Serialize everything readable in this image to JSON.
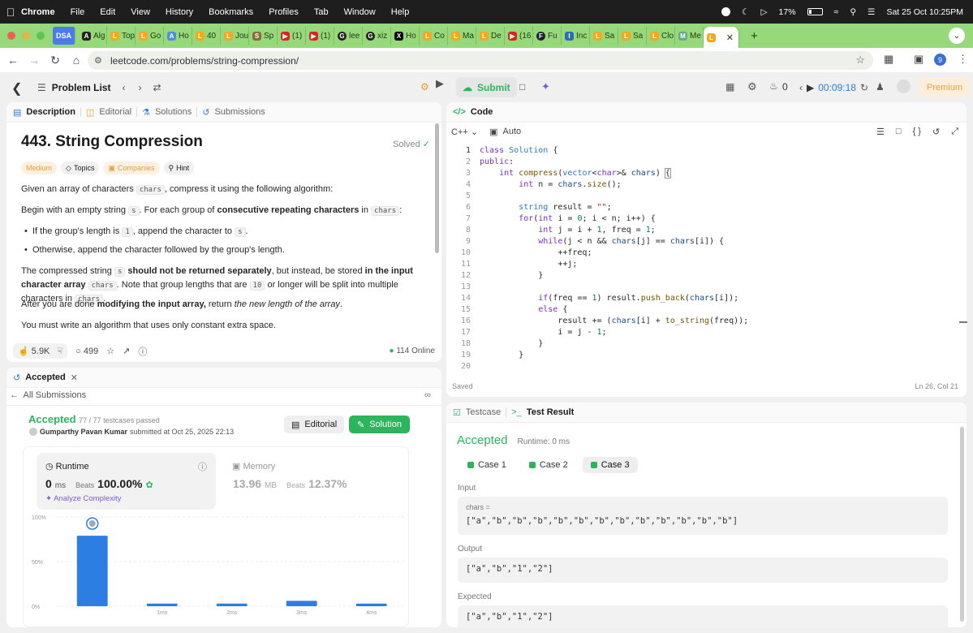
{
  "menubar": {
    "apple": "",
    "items": [
      "Chrome",
      "File",
      "Edit",
      "View",
      "History",
      "Bookmarks",
      "Profiles",
      "Tab",
      "Window",
      "Help"
    ],
    "battery": "17%",
    "datetime": "Sat 25 Oct  10:25PM"
  },
  "tabs": [
    {
      "label": "DSA"
    },
    {
      "label": "Alg"
    },
    {
      "label": "Top"
    },
    {
      "label": "Go"
    },
    {
      "label": "Ho"
    },
    {
      "label": "40"
    },
    {
      "label": "Jou"
    },
    {
      "label": "Sp"
    },
    {
      "label": "(1)"
    },
    {
      "label": "(1)"
    },
    {
      "label": "lee"
    },
    {
      "label": "xiz"
    },
    {
      "label": "Ho"
    },
    {
      "label": "Co"
    },
    {
      "label": "Ma"
    },
    {
      "label": "De"
    },
    {
      "label": "(16"
    },
    {
      "label": "Fu"
    },
    {
      "label": "Inc"
    },
    {
      "label": "Sa"
    },
    {
      "label": "Sa"
    },
    {
      "label": "Clo"
    },
    {
      "label": "Me"
    }
  ],
  "address": {
    "url": "leetcode.com/problems/string-compression/",
    "profile_initial": "9"
  },
  "lc": {
    "problem_list": "Problem List",
    "submit": "Submit",
    "streak": "0",
    "timer": "00:09:18",
    "premium": "Premium"
  },
  "desc": {
    "tabs": {
      "description": "Description",
      "editorial": "Editorial",
      "solutions": "Solutions",
      "submissions": "Submissions"
    },
    "title": "443. String Compression",
    "solved": "Solved",
    "pills": {
      "difficulty": "Medium",
      "topics": "Topics",
      "companies": "Companies",
      "hint": "Hint"
    },
    "p1a": "Given an array of characters ",
    "p1code": "chars",
    "p1b": ", compress it using the following algorithm:",
    "p2a": "Begin with an empty string ",
    "p2code": "s",
    "p2b": ". For each group of ",
    "p2bold": "consecutive repeating characters",
    "p2c": " in ",
    "p2code2": "chars",
    "p2d": ":",
    "b1a": "If the group's length is ",
    "b1code": "1",
    "b1b": ", append the character to ",
    "b1code2": "s",
    "b1c": ".",
    "b2": "Otherwise, append the character followed by the group's length.",
    "p3a": "The compressed string ",
    "p3code": "s",
    "p3bold": " should not be returned separately",
    "p3b": ", but instead, be stored ",
    "p3bold2": "in the input character array",
    "p3code2": "chars",
    "p3c": ". Note that group lengths that are ",
    "p3code3": "10",
    "p3d": " or longer will be split into multiple characters in ",
    "p3code4": "chars",
    "p3e": ".",
    "p4a": "After you are done ",
    "p4bold": "modifying the input array,",
    "p4b": " return ",
    "p4ital": "the new length of the array",
    "p4c": ".",
    "p5": "You must write an algorithm that uses only constant extra space.",
    "likes": "5.9K",
    "comments": "499",
    "online": "114 Online"
  },
  "code": {
    "header": "Code",
    "lang": "C++",
    "mode": "Auto",
    "saved": "Saved",
    "cursor": "Ln 26, Col 21",
    "lines": [
      "1",
      "2",
      "3",
      "4",
      "5",
      "6",
      "7",
      "8",
      "9",
      "10",
      "11",
      "12",
      "13",
      "14",
      "15",
      "16",
      "17",
      "18",
      "19",
      "20"
    ]
  },
  "accepted_panel": {
    "tab": "Accepted",
    "all": "All Submissions",
    "status": "Accepted",
    "tests": "77 / 77 testcases passed",
    "user": "Gumparthy Pavan Kumar",
    "submitted": "submitted at Oct 25, 2025 22:13",
    "editorial": "Editorial",
    "solution": "Solution",
    "runtime_label": "Runtime",
    "runtime_val": "0",
    "runtime_unit": "ms",
    "beats": "Beats",
    "runtime_beats": "100.00%",
    "analyze": "Analyze Complexity",
    "memory_label": "Memory",
    "memory_val": "13.96",
    "memory_unit": "MB",
    "memory_beats": "12.37%",
    "chart_data": {
      "type": "bar",
      "categories": [
        "",
        "1ms",
        "2ms",
        "3ms",
        "4ms"
      ],
      "values": [
        79,
        3,
        3,
        6,
        3
      ],
      "ylim": [
        0,
        100
      ],
      "yticks": [
        "100%",
        "50%",
        "0%"
      ],
      "highlight_index": 0
    }
  },
  "result": {
    "testcase": "Testcase",
    "test_result": "Test Result",
    "status": "Accepted",
    "runtime": "Runtime: 0 ms",
    "cases": [
      "Case 1",
      "Case 2",
      "Case 3"
    ],
    "input_label": "Input",
    "var": "chars =",
    "input": "[\"a\",\"b\",\"b\",\"b\",\"b\",\"b\",\"b\",\"b\",\"b\",\"b\",\"b\",\"b\",\"b\"]",
    "output_label": "Output",
    "output": "[\"a\",\"b\",\"1\",\"2\"]",
    "expected_label": "Expected",
    "expected": "[\"a\",\"b\",\"1\",\"2\"]"
  }
}
